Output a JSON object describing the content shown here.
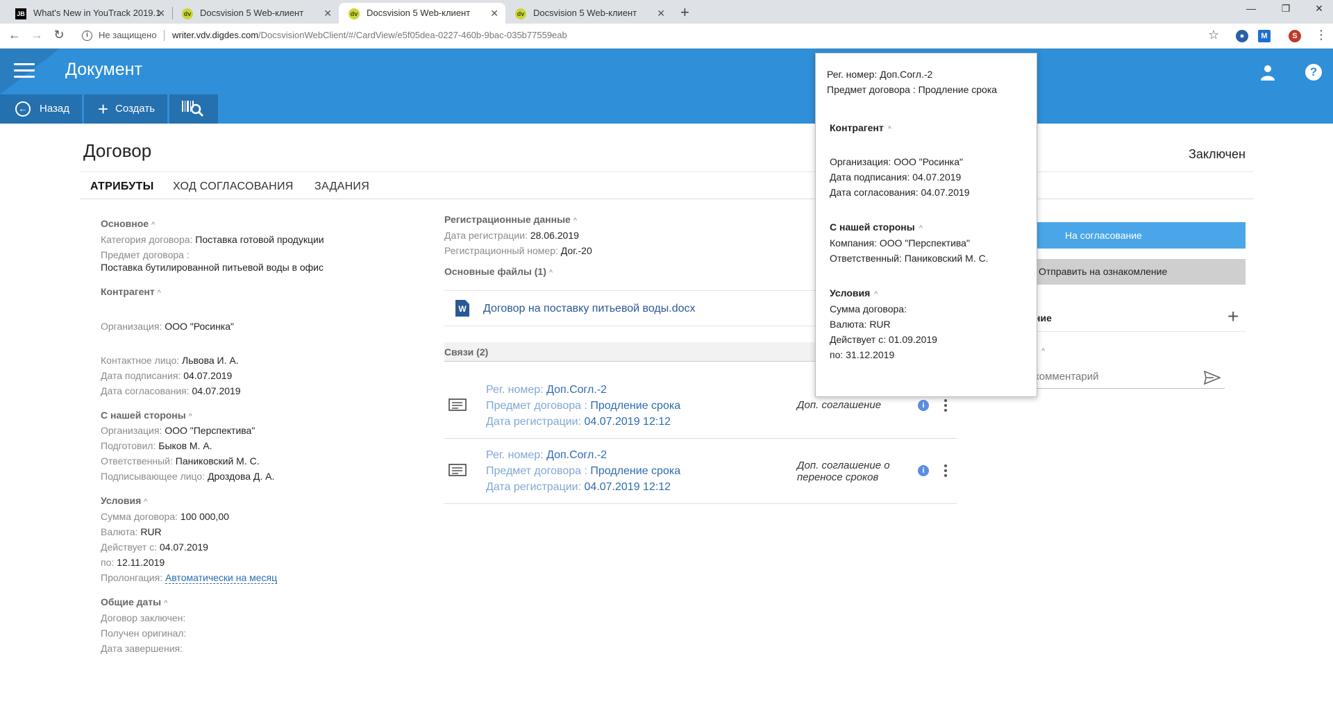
{
  "browser": {
    "tabs": [
      {
        "title": "What's New in YouTrack 2019.1",
        "favicon": "JB"
      },
      {
        "title": "Docsvision 5 Web-клиент",
        "favicon": "dv"
      },
      {
        "title": "Docsvision 5 Web-клиент",
        "favicon": "dv"
      },
      {
        "title": "Docsvision 5 Web-клиент",
        "favicon": "dv"
      }
    ],
    "not_secure": "Не защищено",
    "url_host": "writer.vdv.digdes.com",
    "url_path": "/DocsvisionWebClient/#/CardView/e5f05dea-0227-460b-9bac-035b77559eab",
    "profile_letter": "S"
  },
  "app": {
    "title": "Документ",
    "toolbar": {
      "back": "Назад",
      "create": "Создать"
    }
  },
  "card": {
    "title": "Договор",
    "status": "Заключен",
    "tabs": [
      "АТРИБУТЫ",
      "ХОД СОГЛАСОВАНИЯ",
      "ЗАДАНИЯ"
    ]
  },
  "left": {
    "main": {
      "head": "Основное",
      "category_lbl": "Категория договора:",
      "category": "Поставка готовой продукции",
      "subject_lbl": "Предмет договора :",
      "subject": "Поставка бутилированной питьевой воды в офис"
    },
    "contractor": {
      "head": "Контрагент",
      "org_lbl": "Организация:",
      "org": "ООО \"Росинка\"",
      "contact_lbl": "Контактное лицо:",
      "contact": "Львова И. А.",
      "signed_lbl": "Дата подписания:",
      "signed": "04.07.2019",
      "agreed_lbl": "Дата согласования:",
      "agreed": "04.07.2019"
    },
    "our_side": {
      "head": "С нашей стороны",
      "org_lbl": "Организация:",
      "org": "ООО \"Перспектива\"",
      "prepared_lbl": "Подготовил:",
      "prepared": "Быков М. А.",
      "responsible_lbl": "Ответственный:",
      "responsible": "Паниковский М. С.",
      "signer_lbl": "Подписывающее лицо:",
      "signer": "Дроздова Д. А."
    },
    "terms": {
      "head": "Условия",
      "sum_lbl": "Сумма договора:",
      "sum": "100 000,00",
      "currency_lbl": "Валюта:",
      "currency": "RUR",
      "from_lbl": "Действует с:",
      "from": "04.07.2019",
      "to_lbl": "по:",
      "to": "12.11.2019",
      "prolong_lbl": "Пролонгация:",
      "prolong": "Автоматически на   месяц"
    },
    "dates": {
      "head": "Общие даты",
      "concluded_lbl": "Договор заключен:",
      "original_lbl": "Получен оригинал:",
      "completed_lbl": "Дата завершения:"
    }
  },
  "middle": {
    "reg": {
      "head": "Регистрационные данные",
      "date_lbl": "Дата регистрации:",
      "date": "28.06.2019",
      "num_lbl": "Регистрационный номер:",
      "num": "Дог.-20"
    },
    "files_head": "Основные файлы (1)",
    "file_name": "Договор на поставку питьевой воды.docx",
    "links_head": "Связи (2)",
    "links": [
      {
        "num_lbl": "Рег. номер:",
        "num": "Доп.Согл.-2",
        "subj_lbl": "Предмет договора :",
        "subj": "Продление срока",
        "date_lbl": "Дата регистрации:",
        "date": "04.07.2019 12:12",
        "type": "Доп. соглашение"
      },
      {
        "num_lbl": "Рег. номер:",
        "num": "Доп.Согл.-2",
        "subj_lbl": "Предмет договора :",
        "subj": "Продление срока",
        "date_lbl": "Дата регистрации:",
        "date": "04.07.2019 12:12",
        "type": "Доп. соглашение о переносе сроков"
      }
    ]
  },
  "right": {
    "approve": "На согласование",
    "send": "Отправить на ознакомление",
    "section_fragment": "ние",
    "comment_placeholder": "комментарий"
  },
  "popup": {
    "num_lbl": "Рег. номер:",
    "num": "Доп.Согл.-2",
    "subj_lbl": "Предмет договора :",
    "subj": "Продление срока",
    "contractor_head": "Контрагент",
    "org_lbl": "Организация:",
    "org": "ООО \"Росинка\"",
    "signed_lbl": "Дата подписания:",
    "signed": "04.07.2019",
    "agreed_lbl": "Дата согласования:",
    "agreed": "04.07.2019",
    "our_head": "С нашей стороны",
    "company_lbl": "Компания:",
    "company": "ООО \"Перспектива\"",
    "resp_lbl": "Ответственный:",
    "resp": "Паниковский М. С.",
    "terms_head": "Условия",
    "sum_lbl": "Сумма договора:",
    "currency_lbl": "Валюта:",
    "currency": "RUR",
    "from_lbl": "Действует с:",
    "from": "01.09.2019",
    "to_lbl": "по:",
    "to": "31.12.2019"
  },
  "colors": {
    "header": "#2f8fd8",
    "toolbar_btn": "#2570ae",
    "approve": "#4aa6e8",
    "link": "#2b6cb0"
  }
}
